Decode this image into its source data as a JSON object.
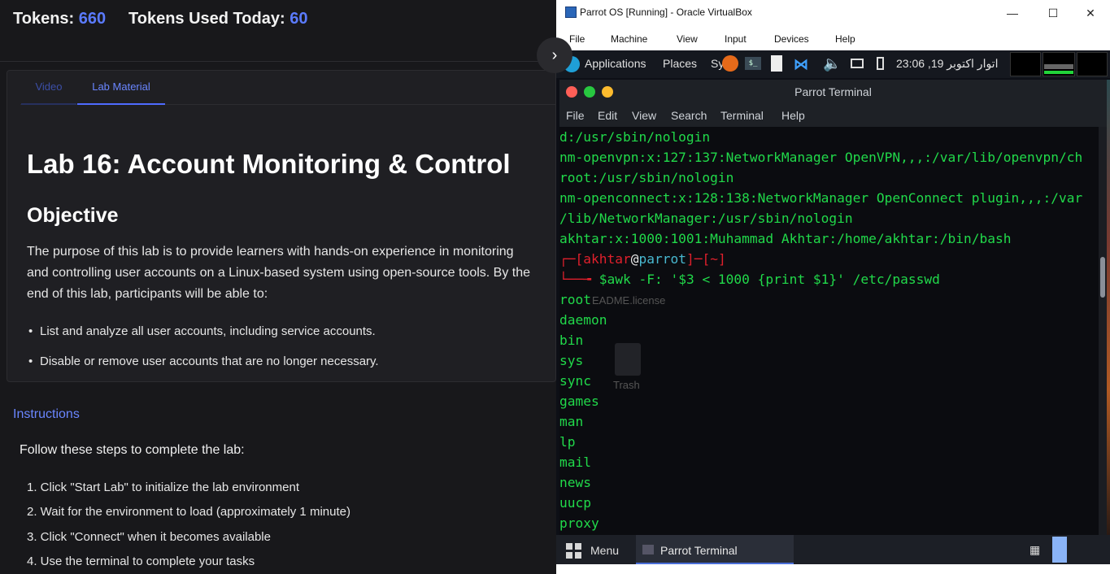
{
  "tokens": {
    "label": "Tokens:",
    "value": "660",
    "used_label": "Tokens Used Today:",
    "used_value": "60"
  },
  "collapse_icon": "chevron-right-icon",
  "tabs": [
    {
      "label": "Video"
    },
    {
      "label": "Lab Material"
    }
  ],
  "lab": {
    "title": "Lab 16: Account Monitoring & Control",
    "objective_heading": "Objective",
    "objective_text": "The purpose of this lab is to provide learners with hands-on experience in monitoring and controlling user accounts on a Linux-based system using open-source tools. By the end of this lab, participants will be able to:",
    "bullets": [
      "List and analyze all user accounts, including service accounts.",
      "Disable or remove user accounts that are no longer necessary."
    ]
  },
  "instructions": {
    "heading": "Instructions",
    "intro": "Follow these steps to complete the lab:",
    "steps": [
      "1. Click \"Start Lab\" to initialize the lab environment",
      "2. Wait for the environment to load (approximately 1 minute)",
      "3. Click \"Connect\" when it becomes available",
      "4. Use the terminal to complete your tasks"
    ]
  },
  "vbox": {
    "title": "Parrot OS [Running] - Oracle VirtualBox",
    "menu": [
      "File",
      "Machine",
      "View",
      "Input",
      "Devices",
      "Help"
    ],
    "controls": {
      "min": "—",
      "max": "☐",
      "close": "✕"
    }
  },
  "guest": {
    "panel": {
      "applications": "Applications",
      "places": "Places",
      "system": "Sy",
      "clock": "23:06 ,19 اتوار اکتوبر"
    },
    "terminal": {
      "title": "Parrot Terminal",
      "menu": [
        "File",
        "Edit",
        "View",
        "Search",
        "Terminal",
        "Help"
      ],
      "lines": [
        "d:/usr/sbin/nologin",
        "nm-openvpn:x:127:137:NetworkManager OpenVPN,,,:/var/lib/openvpn/ch",
        "root:/usr/sbin/nologin",
        "nm-openconnect:x:128:138:NetworkManager OpenConnect plugin,,,:/var",
        "/lib/NetworkManager:/usr/sbin/nologin",
        "akhtar:x:1000:1001:Muhammad Akhtar:/home/akhtar:/bin/bash"
      ],
      "prompt": {
        "user": "akhtar",
        "at": "@",
        "host": "parrot",
        "dir": "~",
        "dollar": "$",
        "cmd": "awk",
        "args": " -F: '$3 < 1000 {print $1}' /etc/passwd"
      },
      "output": [
        "root",
        "daemon",
        "bin",
        "sys",
        "sync",
        "games",
        "man",
        "lp",
        "mail",
        "news",
        "uucp",
        "proxy"
      ],
      "desktop_bg": [
        "EADME.license",
        "Trash"
      ]
    },
    "taskbar": {
      "menu": "Menu",
      "task": "Parrot Terminal"
    }
  }
}
